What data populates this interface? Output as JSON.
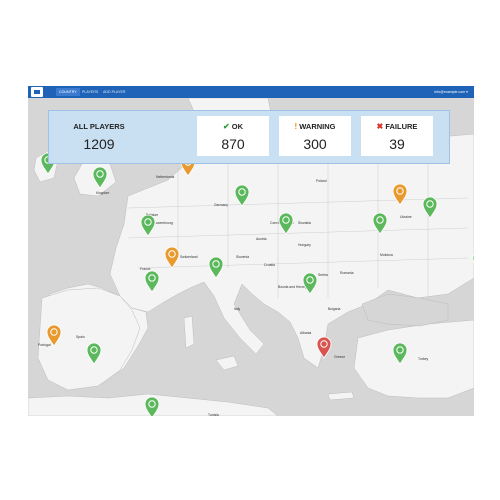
{
  "app": {
    "logo_icon": "app-logo-icon"
  },
  "nav": {
    "tabs": [
      "COUNTRY",
      "PLAYERS",
      "ADD PLAYER"
    ],
    "active_tab": "COUNTRY",
    "user": "info@example.com ▾"
  },
  "stats": {
    "all": {
      "label": "ALL PLAYERS",
      "value": "1209"
    },
    "ok": {
      "label": "OK",
      "value": "870",
      "icon": "check-icon",
      "color": "#2e9e3c"
    },
    "warning": {
      "label": "WARNING",
      "value": "300",
      "icon": "exclamation-icon",
      "color": "#e8900c"
    },
    "failure": {
      "label": "FAILURE",
      "value": "39",
      "icon": "cross-icon",
      "color": "#d9362b"
    }
  },
  "colors": {
    "ok": "#5cb85c",
    "warning": "#e89a2e",
    "failure": "#d9534f",
    "header": "#1e63b8"
  },
  "map": {
    "labels": [
      "Poland",
      "Germany",
      "Netherlands",
      "Belgium",
      "Luxembourg",
      "Czech Republic",
      "Slovakia",
      "Austria",
      "Hungary",
      "Switzerland",
      "France",
      "Italy",
      "Croatia",
      "Bosnia and Herzegovina",
      "Serbia",
      "Romania",
      "Bulgaria",
      "Ukraine",
      "Moldova",
      "Belarus",
      "Greece",
      "Turkey",
      "Albania",
      "Slovenia",
      "Tunisia",
      "Spain",
      "Portugal",
      "Kingdom"
    ],
    "pins": [
      {
        "status": "ok"
      },
      {
        "status": "ok"
      },
      {
        "status": "warning"
      },
      {
        "status": "ok"
      },
      {
        "status": "warning"
      },
      {
        "status": "ok"
      },
      {
        "status": "ok"
      },
      {
        "status": "ok"
      },
      {
        "status": "ok"
      },
      {
        "status": "warning"
      },
      {
        "status": "ok"
      },
      {
        "status": "ok"
      },
      {
        "status": "ok"
      },
      {
        "status": "warning"
      },
      {
        "status": "ok"
      },
      {
        "status": "failure"
      },
      {
        "status": "ok"
      },
      {
        "status": "ok"
      },
      {
        "status": "ok"
      }
    ]
  }
}
